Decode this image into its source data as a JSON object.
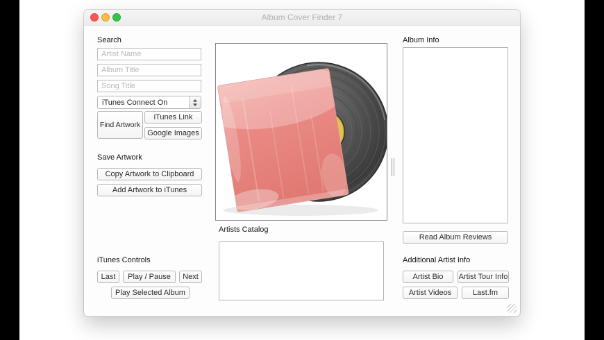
{
  "window": {
    "title": "Album Cover Finder 7"
  },
  "search": {
    "label": "Search",
    "artist_placeholder": "Artist Name",
    "album_placeholder": "Album Title",
    "song_placeholder": "Song Title",
    "connect_select_value": "iTunes Connect On",
    "find_artwork": "Find Artwork",
    "itunes_link": "iTunes Link",
    "google_images": "Google Images"
  },
  "save_artwork": {
    "label": "Save Artwork",
    "copy_to_clipboard": "Copy Artwork to Clipboard",
    "add_to_itunes": "Add Artwork to iTunes"
  },
  "itunes_controls": {
    "label": "iTunes Controls",
    "last": "Last",
    "play_pause": "Play / Pause",
    "next": "Next",
    "play_selected": "Play Selected Album"
  },
  "catalog": {
    "label": "Artists Catalog"
  },
  "album_info": {
    "label": "Album Info",
    "read_reviews": "Read Album Reviews"
  },
  "additional_info": {
    "label": "Additional Artist Info",
    "artist_bio": "Artist Bio",
    "artist_tour": "Artist Tour Info",
    "artist_videos": "Artist Videos",
    "lastfm": "Last.fm"
  },
  "colors": {
    "traffic_red": "#fc5753",
    "traffic_yellow": "#fdbc40",
    "traffic_green": "#33c748",
    "cover_pink": "#e8837e",
    "vinyl_dark": "#3c3c3c",
    "label_yellow": "#e6c14f"
  }
}
